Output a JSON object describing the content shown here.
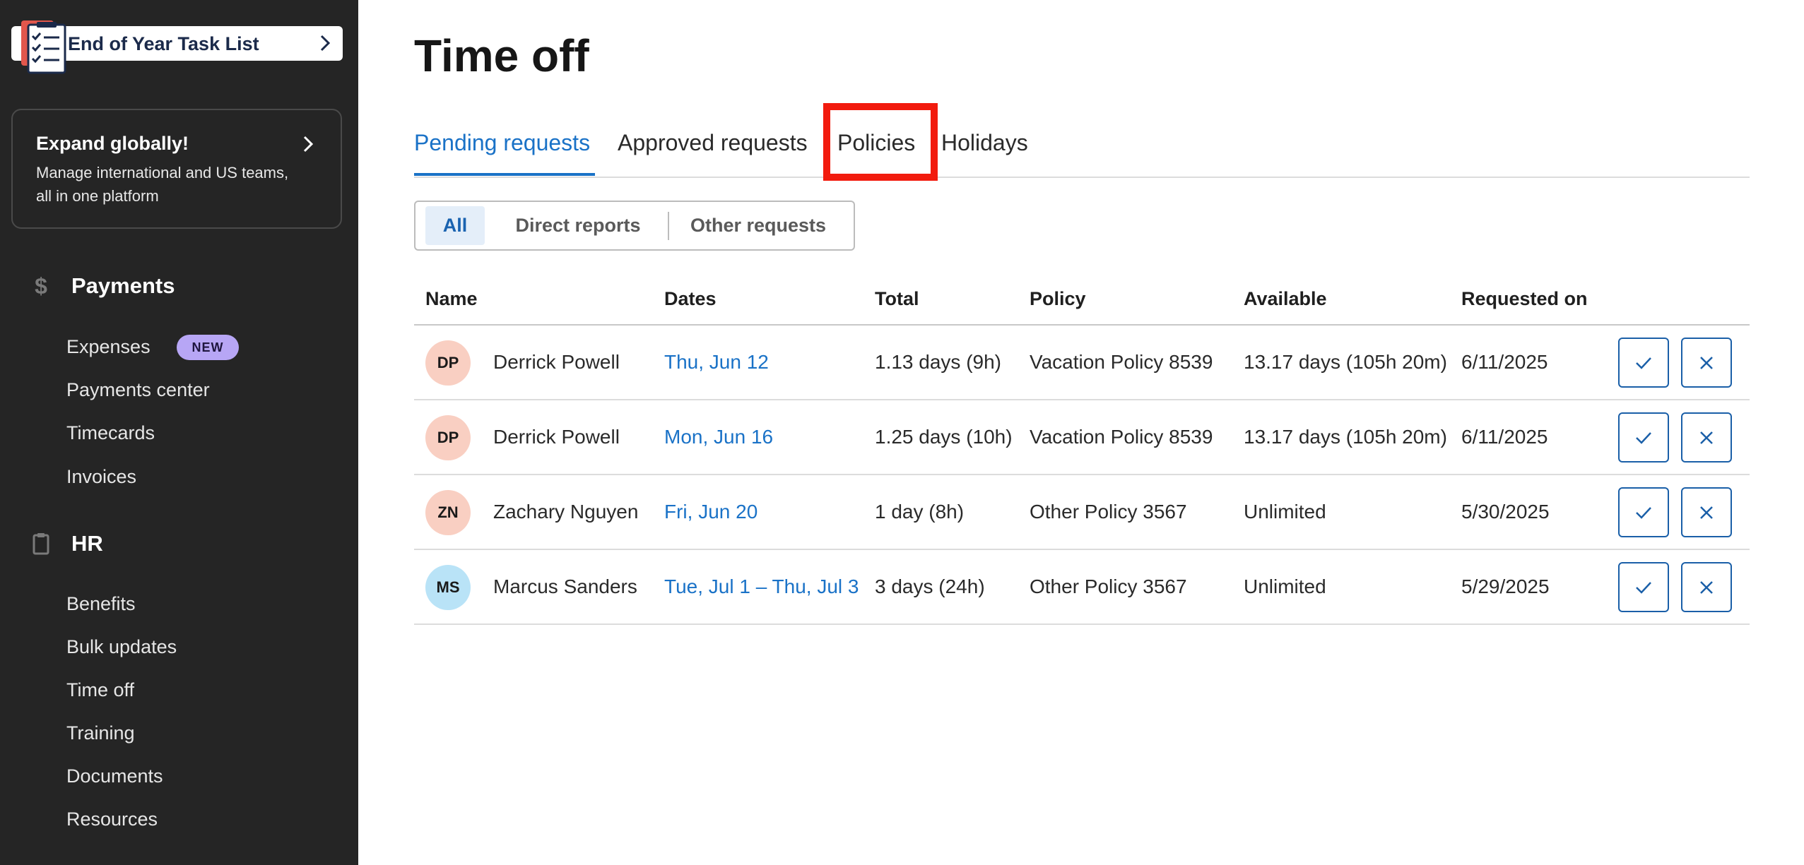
{
  "sidebar": {
    "task_banner": {
      "label": "End of Year Task List",
      "icon": "checklist-icon"
    },
    "promo": {
      "title": "Expand globally!",
      "description": "Manage international and US teams, all in one platform"
    },
    "payments": {
      "icon": "dollar-icon",
      "label": "Payments",
      "items": [
        {
          "label": "Expenses",
          "badge": "NEW"
        },
        {
          "label": "Payments center"
        },
        {
          "label": "Timecards"
        },
        {
          "label": "Invoices"
        }
      ]
    },
    "hr": {
      "icon": "clipboard-icon",
      "label": "HR",
      "items": [
        {
          "label": "Benefits"
        },
        {
          "label": "Bulk updates"
        },
        {
          "label": "Time off"
        },
        {
          "label": "Training"
        },
        {
          "label": "Documents"
        },
        {
          "label": "Resources"
        }
      ]
    }
  },
  "main": {
    "title": "Time off",
    "tabs": [
      {
        "label": "Pending requests",
        "active": true
      },
      {
        "label": "Approved requests"
      },
      {
        "label": "Policies"
      },
      {
        "label": "Holidays"
      }
    ],
    "filters": [
      {
        "label": "All",
        "active": true
      },
      {
        "label": "Direct reports"
      },
      {
        "label": "Other requests"
      }
    ],
    "table": {
      "columns": [
        "Name",
        "Dates",
        "Total",
        "Policy",
        "Available",
        "Requested on"
      ],
      "rows": [
        {
          "initials": "DP",
          "avatar_color": "#f9cfc2",
          "name": "Derrick Powell",
          "dates": "Thu, Jun 12",
          "total": "1.13 days (9h)",
          "policy": "Vacation Policy 8539",
          "available": "13.17 days (105h 20m)",
          "requested_on": "6/11/2025"
        },
        {
          "initials": "DP",
          "avatar_color": "#f9cfc2",
          "name": "Derrick Powell",
          "dates": "Mon, Jun 16",
          "total": "1.25 days (10h)",
          "policy": "Vacation Policy 8539",
          "available": "13.17 days (105h 20m)",
          "requested_on": "6/11/2025"
        },
        {
          "initials": "ZN",
          "avatar_color": "#f9cfc2",
          "name": "Zachary Nguyen",
          "dates": "Fri, Jun 20",
          "total": "1 day (8h)",
          "policy": "Other Policy 3567",
          "available": "Unlimited",
          "requested_on": "5/30/2025"
        },
        {
          "initials": "MS",
          "avatar_color": "#b9e3f7",
          "name": "Marcus Sanders",
          "dates": "Tue, Jul 1 – Thu, Jul 3",
          "total": "3 days (24h)",
          "policy": "Other Policy 3567",
          "available": "Unlimited",
          "requested_on": "5/29/2025"
        }
      ]
    }
  },
  "colors": {
    "accent": "#1a72c7",
    "sidebar_bg": "#252525",
    "highlight": "#f21b0e",
    "badge_new": "#b7a6f5"
  }
}
